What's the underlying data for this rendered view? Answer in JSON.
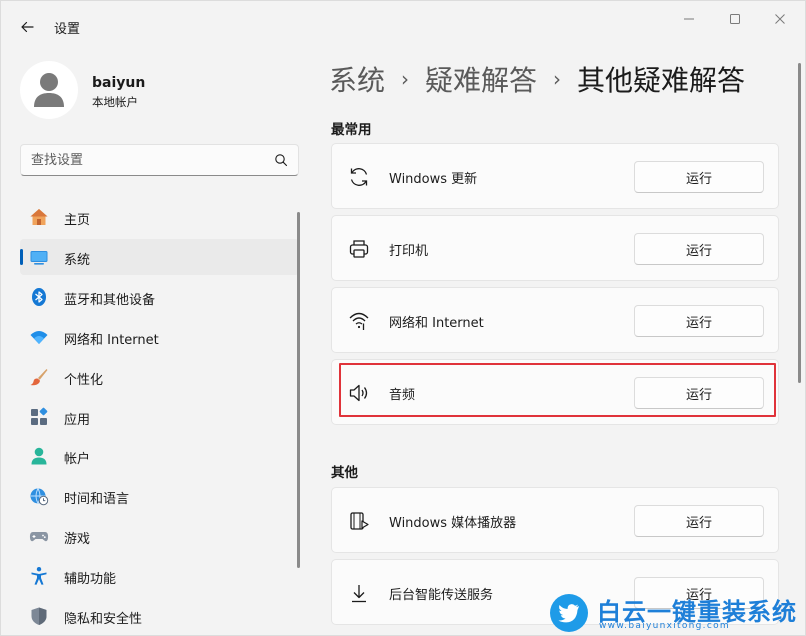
{
  "window": {
    "title": "设置"
  },
  "user": {
    "name": "baiyun",
    "account_type": "本地帐户"
  },
  "search": {
    "placeholder": "查找设置"
  },
  "nav": {
    "items": [
      {
        "label": "主页",
        "icon": "home-icon"
      },
      {
        "label": "系统",
        "icon": "system-icon",
        "selected": true
      },
      {
        "label": "蓝牙和其他设备",
        "icon": "bluetooth-icon"
      },
      {
        "label": "网络和 Internet",
        "icon": "wifi-icon"
      },
      {
        "label": "个性化",
        "icon": "brush-icon"
      },
      {
        "label": "应用",
        "icon": "apps-icon"
      },
      {
        "label": "帐户",
        "icon": "account-icon"
      },
      {
        "label": "时间和语言",
        "icon": "globe-clock-icon"
      },
      {
        "label": "游戏",
        "icon": "gamepad-icon"
      },
      {
        "label": "辅助功能",
        "icon": "accessibility-icon"
      },
      {
        "label": "隐私和安全性",
        "icon": "shield-icon"
      }
    ]
  },
  "breadcrumb": {
    "items": [
      "系统",
      "疑难解答"
    ],
    "current": "其他疑难解答",
    "separator": "›"
  },
  "sections": [
    {
      "title": "最常用",
      "items": [
        {
          "label": "Windows 更新",
          "icon": "sync-icon",
          "button": "运行"
        },
        {
          "label": "打印机",
          "icon": "printer-icon",
          "button": "运行"
        },
        {
          "label": "网络和 Internet",
          "icon": "network-icon",
          "button": "运行"
        },
        {
          "label": "音频",
          "icon": "speaker-icon",
          "button": "运行",
          "highlighted": true
        }
      ]
    },
    {
      "title": "其他",
      "items": [
        {
          "label": "Windows 媒体播放器",
          "icon": "media-player-icon",
          "button": "运行"
        },
        {
          "label": "后台智能传送服务",
          "icon": "download-icon",
          "button": "运行"
        }
      ]
    }
  ],
  "watermark": {
    "title": "白云一键重装系统",
    "url": "www.baiyunxitong.com",
    "icon": "twitter-bird-icon"
  },
  "colors": {
    "accent": "#005fb8",
    "highlight": "#e0333a",
    "background": "#f3f3f3",
    "card": "#fbfbfb",
    "watermark": "#1e7fd8"
  }
}
